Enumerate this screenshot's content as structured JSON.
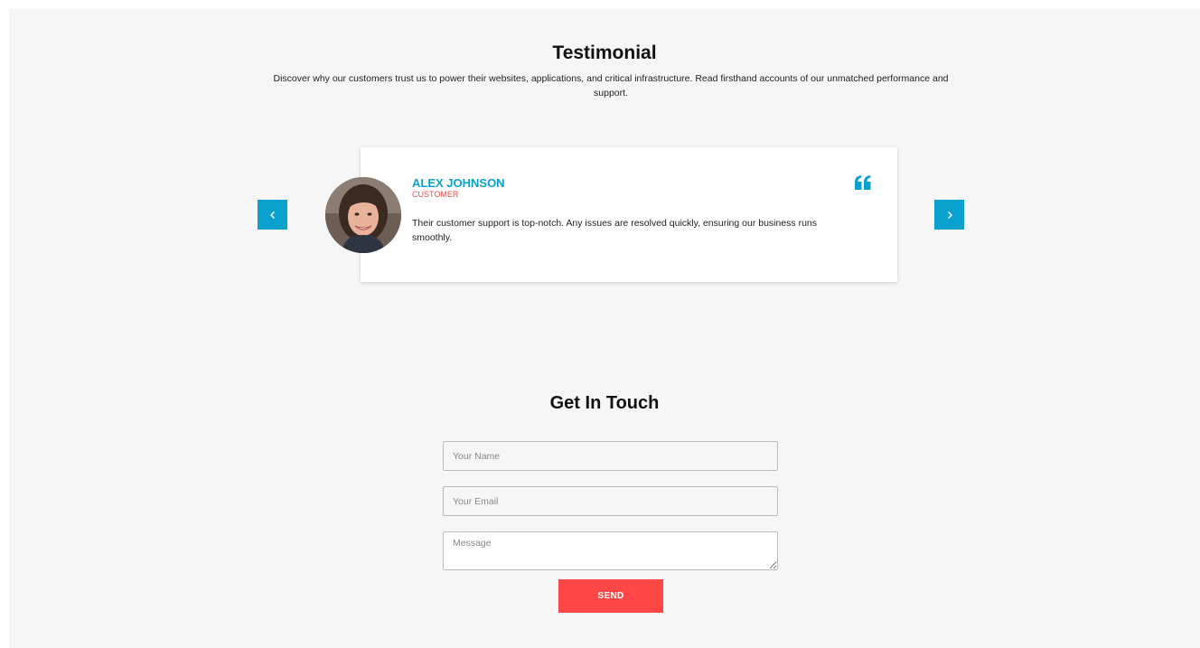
{
  "testimonial": {
    "title": "Testimonial",
    "description": "Discover why our customers trust us to power their websites, applications, and critical infrastructure. Read firsthand accounts of our unmatched performance and support.",
    "prev_icon": "chevron-left-icon",
    "next_icon": "chevron-right-icon",
    "card": {
      "name": "ALEX JOHNSON",
      "role": "CUSTOMER",
      "quote": "Their customer support is top-notch. Any issues are resolved quickly, ensuring our business runs smoothly.",
      "quote_icon": "quote-icon"
    }
  },
  "contact": {
    "title": "Get In Touch",
    "name_placeholder": "Your Name",
    "email_placeholder": "Your Email",
    "message_placeholder": "Message",
    "send_label": "SEND"
  },
  "colors": {
    "accent_blue": "#0aa1cf",
    "accent_red": "#ff4747",
    "background": "#f6f6f6"
  }
}
